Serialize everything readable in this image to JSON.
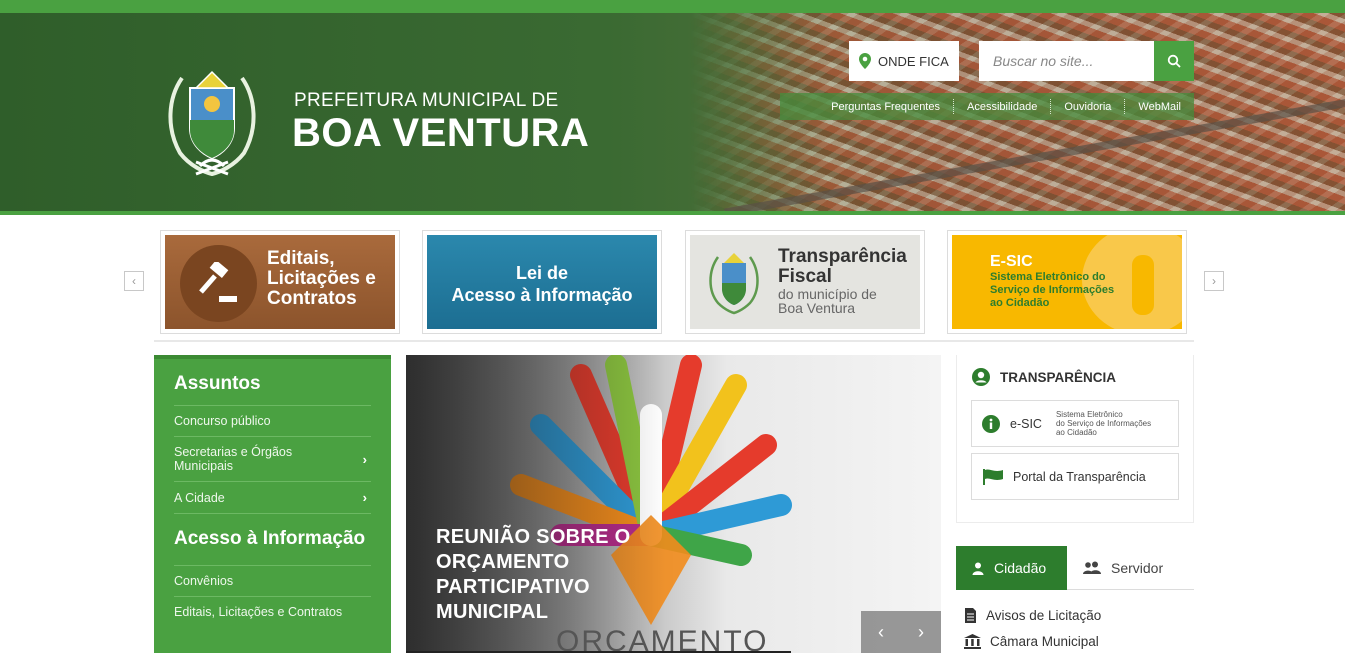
{
  "header": {
    "brand_small": "PREFEITURA MUNICIPAL DE",
    "brand_big": "BOA VENTURA",
    "onde_fica": "ONDE FICA",
    "search_placeholder": "Buscar no site...",
    "quicklinks": [
      "Perguntas Frequentes",
      "Acessibilidade",
      "Ouvidoria",
      "WebMail"
    ]
  },
  "banners": [
    {
      "line1": "Editais,",
      "line2": "Licitações e",
      "line3": "Contratos"
    },
    {
      "line1": "Lei de",
      "line2": "Acesso à Informação"
    },
    {
      "line1": "Transparência",
      "line2": "Fiscal",
      "line3": "do município de",
      "line4": "Boa Ventura"
    },
    {
      "line1": "E-SIC",
      "line2": "Sistema Eletrônico do",
      "line3": "Serviço de Informações",
      "line4": "ao Cidadão"
    }
  ],
  "sidebar": {
    "heading1": "Assuntos",
    "items1": [
      "Concurso público",
      "Secretarias e Órgãos Municipais",
      "A Cidade"
    ],
    "heading2": "Acesso à Informação",
    "items2": [
      "Convênios",
      "Editais, Licitações e Contratos"
    ]
  },
  "hero": {
    "title": "REUNIÃO SOBRE O ORÇAMENTO PARTICIPATIVO MUNICIPAL",
    "image_text": "ORÇAMENTO"
  },
  "transparencia": {
    "heading": "TRANSPARÊNCIA",
    "esic_label": "e-SIC",
    "esic_desc_1": "Sistema Eletrônico",
    "esic_desc_2": "do Serviço de Informações",
    "esic_desc_3": "ao Cidadão",
    "portal_label": "Portal da Transparência"
  },
  "tabs": {
    "cidadao": "Cidadão",
    "servidor": "Servidor"
  },
  "links": [
    "Avisos de Licitação",
    "Câmara Municipal"
  ],
  "colors": {
    "green": "#4aa141",
    "dark_green": "#2d7d2d",
    "orange_banner": "#a96a3c",
    "blue_banner": "#2b88ad",
    "yellow_banner": "#f8b800"
  }
}
